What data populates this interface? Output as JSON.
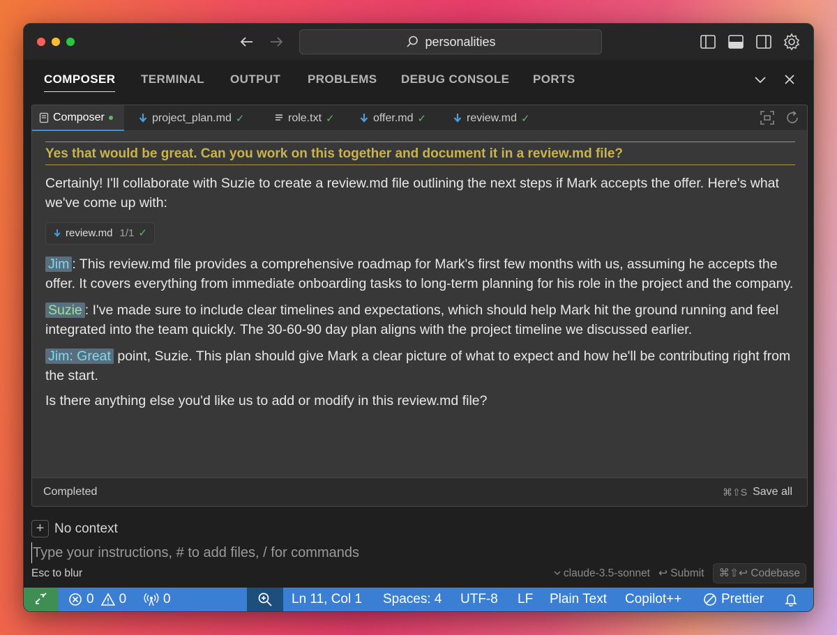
{
  "titlebar": {
    "search_text": "personalities"
  },
  "panel_tabs": [
    "COMPOSER",
    "TERMINAL",
    "OUTPUT",
    "PROBLEMS",
    "DEBUG CONSOLE",
    "PORTS"
  ],
  "composer_tabs": {
    "active": "Composer",
    "files": [
      {
        "name": "project_plan.md",
        "check": "✓"
      },
      {
        "name": "role.txt",
        "check": "✓"
      },
      {
        "name": "offer.md",
        "check": "✓"
      },
      {
        "name": "review.md",
        "check": "✓"
      }
    ]
  },
  "chat": {
    "user_message": "Yes that would be great. Can you work on this together and document it in a review.md file?",
    "intro": "Certainly! I'll collaborate with Suzie to create a review.md file outlining the next steps if Mark accepts the offer. Here's what we've come up with:",
    "file_chip": {
      "name": "review.md",
      "count": "1/1",
      "check": "✓"
    },
    "lines": [
      {
        "speaker": "Jim",
        "text": ": This review.md file provides a comprehensive roadmap for Mark's first few months with us, assuming he accepts the offer. It covers everything from immediate onboarding tasks to long-term planning for his role in the project and the company."
      },
      {
        "speaker": "Suzie",
        "text": ": I've made sure to include clear timelines and expectations, which should help Mark hit the ground running and feel integrated into the team quickly. The 30-60-90 day plan aligns with the project timeline we discussed earlier."
      },
      {
        "speaker": "Jim: Great",
        "text": " point, Suzie. This plan should give Mark a clear picture of what to expect and how he'll be contributing right from the start."
      }
    ],
    "closing": "Is there anything else you'd like us to add or modify in this review.md file?"
  },
  "composer_footer": {
    "status": "Completed",
    "save_shortcut": "⌘⇧S",
    "save_label": "Save all"
  },
  "input": {
    "context_label": "No context",
    "placeholder": "Type your instructions, # to add files, / for commands",
    "esc_hint": "Esc to blur",
    "model": "claude-3.5-sonnet",
    "submit": "↩ Submit",
    "codebase": "⌘⇧↩ Codebase"
  },
  "statusbar": {
    "errors": "0",
    "warnings": "0",
    "ports": "0",
    "position": "Ln 11, Col 1",
    "spaces": "Spaces: 4",
    "encoding": "UTF-8",
    "eol": "LF",
    "language": "Plain Text",
    "copilot": "Copilot++",
    "prettier": "Prettier"
  },
  "colors": {
    "accent_blue": "#3a7fd3",
    "remote_green": "#3f8f55",
    "user_msg_gold": "#c9b44a",
    "jim_cyan": "#7fd8f2",
    "suzie_green": "#9ee29f"
  }
}
